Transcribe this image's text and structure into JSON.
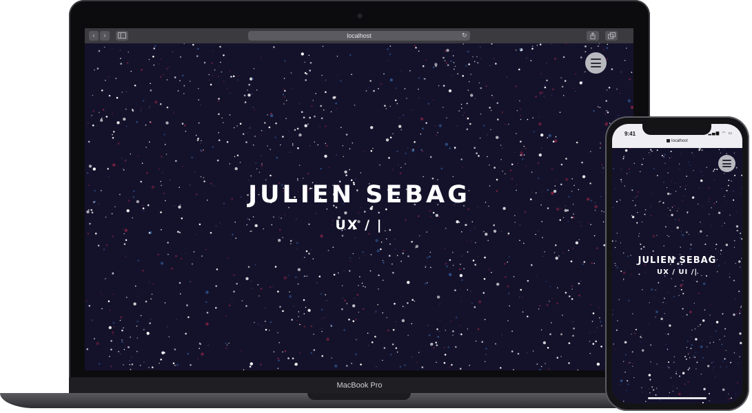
{
  "browser": {
    "url": "localhost",
    "back_glyph": "‹",
    "forward_glyph": "›",
    "reload_glyph": "↻",
    "icons": [
      "chevron-left-icon",
      "chevron-right-icon",
      "sidebar-icon",
      "share-icon",
      "tabs-icon",
      "reload-icon"
    ]
  },
  "site": {
    "title": "JULIEN SEBAG",
    "subtitle": "UX / |",
    "menu_icon": "hamburger-icon",
    "background": "#14122b",
    "star_colors": [
      "#ffffff",
      "#2c4f86",
      "#7a2040"
    ]
  },
  "device": {
    "laptop_label": "MacBook Pro"
  },
  "phone": {
    "time": "9:41",
    "status_icons": "▂▄▆ ◠ ▭",
    "url": "localhost",
    "title": "JULIEN SEBAG",
    "subtitle": "UX / UI /|"
  }
}
